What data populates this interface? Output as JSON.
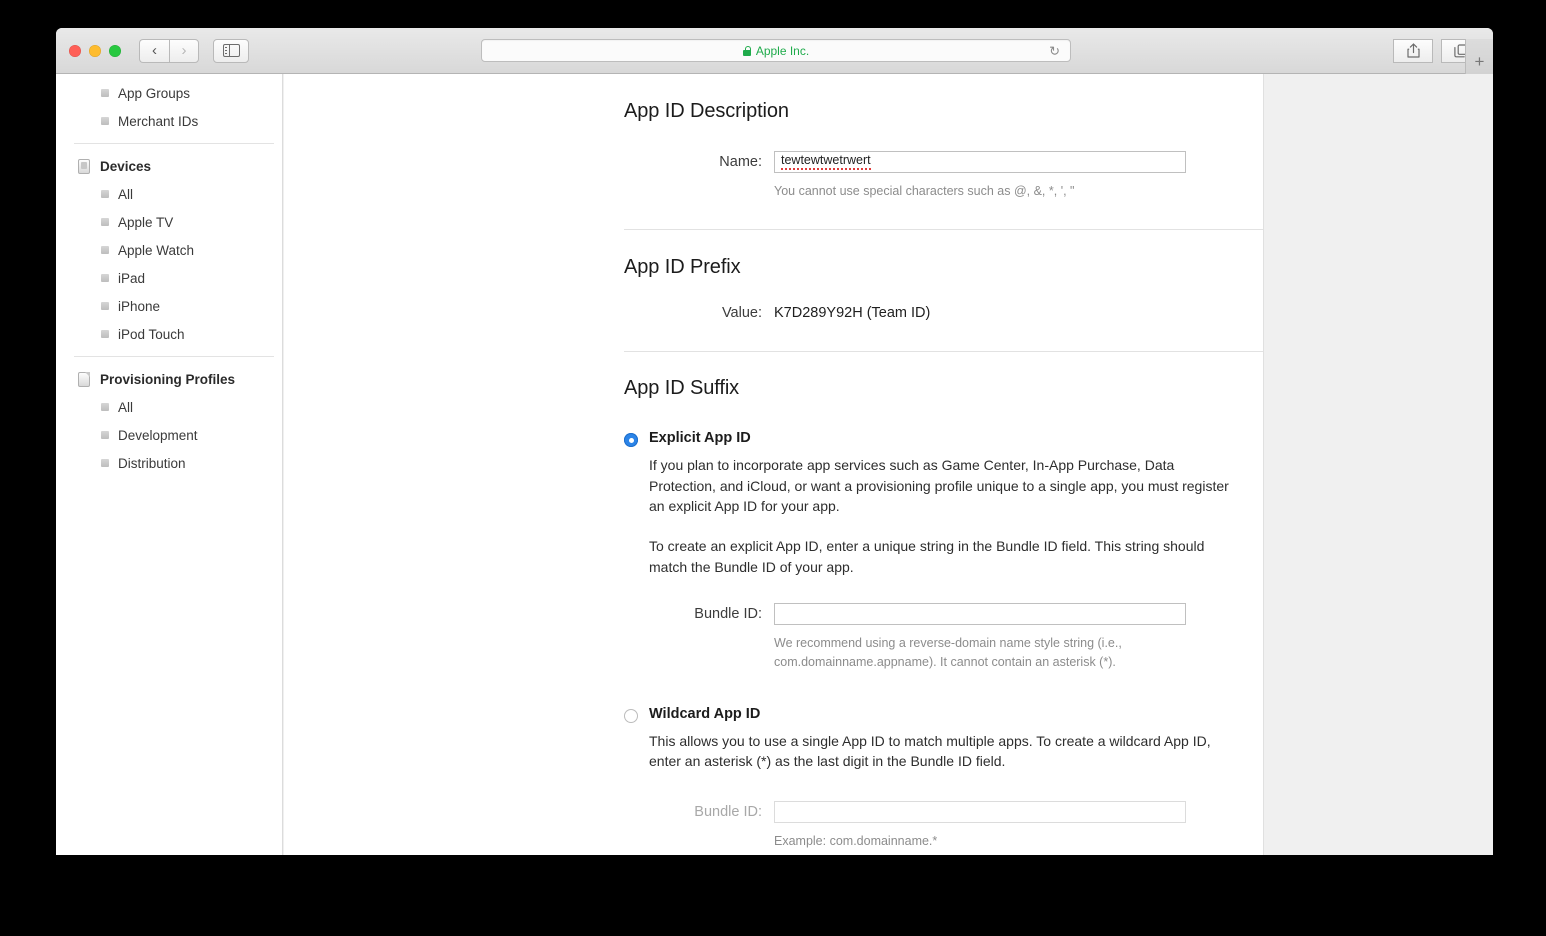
{
  "browser": {
    "window_title": "Apple Inc.",
    "url_label": "Apple Inc.",
    "lock_icon": "lock-icon",
    "reload_icon": "↻",
    "back_icon": "‹",
    "forward_icon": "›",
    "sidebar_toggle_icon": "sidebar-icon",
    "share_icon": "⇪",
    "tabs_icon": "tabs-icon",
    "new_tab_icon": "+",
    "accent_green": "#1fab4b"
  },
  "sidebar": {
    "items": [
      {
        "label": "App Groups",
        "type": "leaf"
      },
      {
        "label": "Merchant IDs",
        "type": "leaf"
      },
      {
        "label": "Devices",
        "type": "group",
        "icon": "device-icon"
      },
      {
        "label": "All",
        "type": "leaf"
      },
      {
        "label": "Apple TV",
        "type": "leaf"
      },
      {
        "label": "Apple Watch",
        "type": "leaf"
      },
      {
        "label": "iPad",
        "type": "leaf"
      },
      {
        "label": "iPhone",
        "type": "leaf"
      },
      {
        "label": "iPod Touch",
        "type": "leaf"
      },
      {
        "label": "Provisioning Profiles",
        "type": "group",
        "icon": "document-icon"
      },
      {
        "label": "All",
        "type": "leaf"
      },
      {
        "label": "Development",
        "type": "leaf"
      },
      {
        "label": "Distribution",
        "type": "leaf"
      }
    ]
  },
  "main": {
    "description": {
      "heading": "App ID Description",
      "name_label": "Name:",
      "name_value": "tewtewtwetrwert",
      "name_hint": "You cannot use special characters such as @, &, *, ', \""
    },
    "prefix": {
      "heading": "App ID Prefix",
      "value_label": "Value:",
      "value": "K7D289Y92H (Team ID)"
    },
    "suffix": {
      "heading": "App ID Suffix",
      "explicit": {
        "title": "Explicit App ID",
        "selected": true,
        "paragraph_1": "If you plan to incorporate app services such as Game Center, In-App Purchase, Data Protection, and iCloud, or want a provisioning profile unique to a single app, you must register an explicit App ID for your app.",
        "paragraph_2": "To create an explicit App ID, enter a unique string in the Bundle ID field. This string should match the Bundle ID of your app.",
        "bundle_label": "Bundle ID:",
        "bundle_value": "",
        "bundle_hint": "We recommend using a reverse-domain name style string (i.e., com.domainname.appname). It cannot contain an asterisk (*)."
      },
      "wildcard": {
        "title": "Wildcard App ID",
        "selected": false,
        "paragraph_1": "This allows you to use a single App ID to match multiple apps. To create a wildcard App ID, enter an asterisk (*) as the last digit in the Bundle ID field.",
        "bundle_label": "Bundle ID:",
        "bundle_value": "",
        "bundle_hint": "Example: com.domainname.*"
      }
    }
  }
}
